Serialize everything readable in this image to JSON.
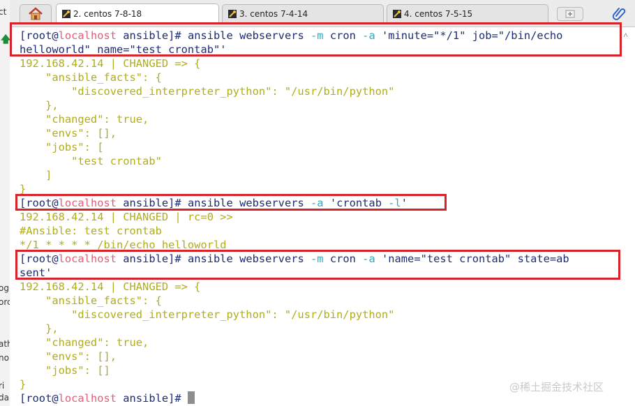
{
  "left_panel": {
    "fragments": [
      "ct",
      "og",
      "orc",
      "ath",
      "no",
      "ri",
      "da"
    ]
  },
  "tabs": [
    {
      "label": "2. centos 7-8-18",
      "active": true
    },
    {
      "label": "3. centos 7-4-14",
      "active": false
    },
    {
      "label": "4. centos 7-5-15",
      "active": false
    }
  ],
  "terminal": {
    "cmd1": {
      "user": "[root@",
      "host": "localhost",
      "path": " ansible]# ",
      "cmd": "ansible webservers ",
      "opt_m": "-m",
      "mod": " cron ",
      "opt_a": "-a",
      "arg_line1": " 'minute=\"*/1\" job=\"/bin/echo",
      "arg_line2": "helloworld\" name=\"test crontab\"'"
    },
    "out1": [
      "192.168.42.14 | CHANGED => {",
      "    \"ansible_facts\": {",
      "        \"discovered_interpreter_python\": \"/usr/bin/python\"",
      "    },",
      "    \"changed\": true,",
      "    \"envs\": [],",
      "    \"jobs\": [",
      "        \"test crontab\"",
      "    ]",
      "}"
    ],
    "cmd2": {
      "user": "[root@",
      "host": "localhost",
      "path": " ansible]# ",
      "cmd": "ansible webservers ",
      "opt_a": "-a",
      "arg": " 'crontab ",
      "opt_l": "-l",
      "arg_end": "'"
    },
    "out2": [
      "192.168.42.14 | CHANGED | rc=0 >>",
      "#Ansible: test crontab",
      "*/1 * * * * /bin/echo helloworld"
    ],
    "cmd3": {
      "user": "[root@",
      "host": "localhost",
      "path": " ansible]# ",
      "cmd": "ansible webservers ",
      "opt_m": "-m",
      "mod": " cron ",
      "opt_a": "-a",
      "arg_line1": " 'name=\"test crontab\" state=ab",
      "arg_line2": "sent'"
    },
    "out3": [
      "192.168.42.14 | CHANGED => {",
      "    \"ansible_facts\": {",
      "        \"discovered_interpreter_python\": \"/usr/bin/python\"",
      "    },",
      "    \"changed\": true,",
      "    \"envs\": [],",
      "    \"jobs\": []",
      "}"
    ],
    "prompt": {
      "user": "[root@",
      "host": "localhost",
      "path": " ansible]# "
    }
  },
  "watermark": "@稀土掘金技术社区",
  "colors": {
    "highlight": "#d9232a",
    "output": "#b0ad1c",
    "prompt": "#1e2b73",
    "host": "#e0607a",
    "option": "#2fa9c4"
  }
}
